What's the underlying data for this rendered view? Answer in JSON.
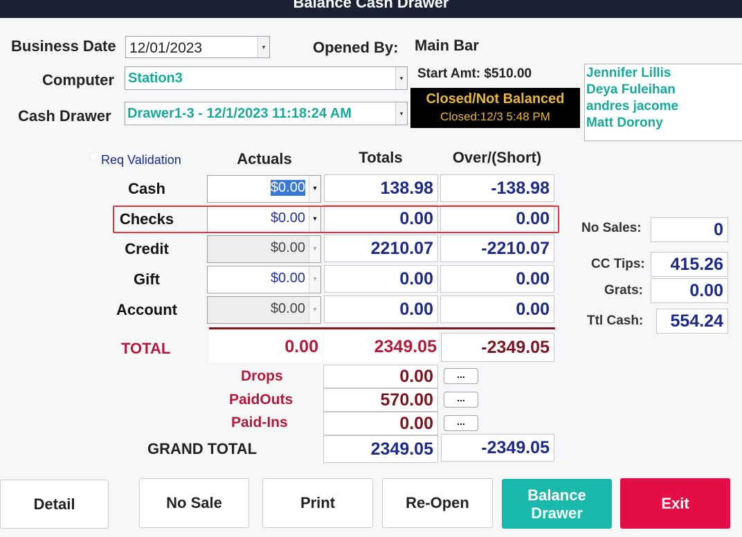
{
  "window": {
    "title": "Balance Cash Drawer"
  },
  "header": {
    "business_date_label": "Business Date",
    "business_date_value": "12/01/2023",
    "opened_by_label": "Opened By:",
    "opened_by_value": "Main Bar",
    "computer_label": "Computer",
    "computer_value": "Station3",
    "cash_drawer_label": "Cash Drawer",
    "cash_drawer_value": "Drawer1-3 - 12/1/2023 11:18:24 AM",
    "start_amt": "Start Amt: $510.00",
    "status_title": "Closed/Not Balanced",
    "status_closed": "Closed:12/3 5:48 PM"
  },
  "employees": [
    "Jennifer Lillis",
    "Deya Fuleihan",
    "andres jacome",
    "Matt Dorony"
  ],
  "table": {
    "req_validation_label": "Req Validation",
    "columns": [
      "Actuals",
      "Totals",
      "Over/(Short)"
    ],
    "rows": [
      {
        "label": "Cash",
        "actual": "$0.00",
        "total": "138.98",
        "over": "-138.98"
      },
      {
        "label": "Checks",
        "actual": "$0.00",
        "total": "0.00",
        "over": "0.00"
      },
      {
        "label": "Credit",
        "actual": "$0.00",
        "total": "2210.07",
        "over": "-2210.07"
      },
      {
        "label": "Gift",
        "actual": "$0.00",
        "total": "0.00",
        "over": "0.00"
      },
      {
        "label": "Account",
        "actual": "$0.00",
        "total": "0.00",
        "over": "0.00"
      }
    ],
    "total_label": "TOTAL",
    "total_actual": "0.00",
    "total_totals": "2349.05",
    "total_over": "-2349.05",
    "drops_label": "Drops",
    "drops_value": "0.00",
    "paidouts_label": "PaidOuts",
    "paidouts_value": "570.00",
    "paidins_label": "Paid-Ins",
    "paidins_value": "0.00",
    "more_label": "...",
    "grand_total_label": "GRAND TOTAL",
    "grand_total_totals": "2349.05",
    "grand_total_over": "-2349.05"
  },
  "side": {
    "no_sales_label": "No Sales:",
    "no_sales_value": "0",
    "cc_tips_label": "CC Tips:",
    "cc_tips_value": "415.26",
    "grats_label": "Grats:",
    "grats_value": "0.00",
    "ttl_cash_label": "Ttl Cash:",
    "ttl_cash_value": "554.24"
  },
  "buttons": {
    "detail": "Detail",
    "no_sale": "No Sale",
    "print": "Print",
    "reopen": "Re-Open",
    "balance_line1": "Balance",
    "balance_line2": "Drawer",
    "exit": "Exit"
  },
  "colors": {
    "title_bar": "#1b2233",
    "teal_text": "#17a89a",
    "status_gold": "#e8b93c",
    "red_label": "#b11a3a",
    "balance_button": "#1bb8ac",
    "exit_button": "#e50d45",
    "highlight_border": "#d9383f"
  }
}
